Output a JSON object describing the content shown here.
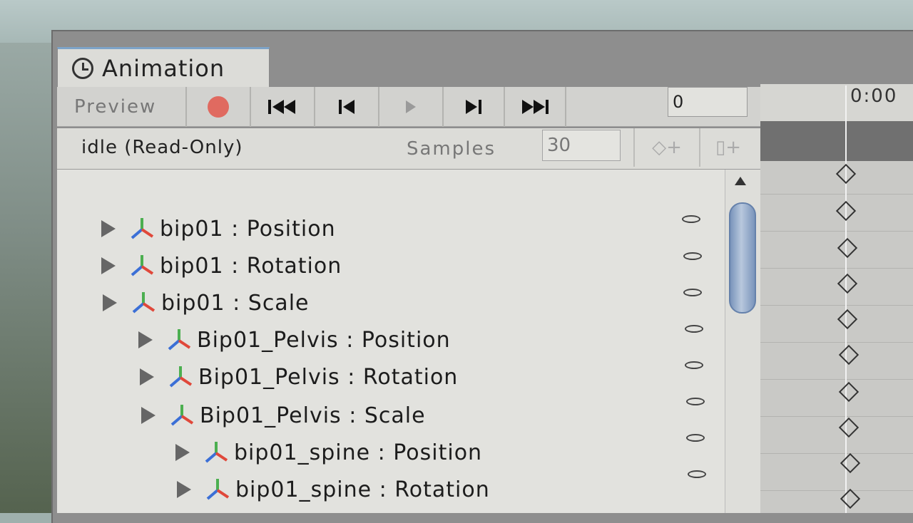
{
  "window": {
    "tab_title": "Animation"
  },
  "toolbar": {
    "preview_label": "Preview",
    "record_color": "#e06a60",
    "first_key_glyph": "⏮",
    "prev_key_glyph": "⏮",
    "play_glyph": "▶",
    "next_key_glyph": "⏭",
    "last_key_glyph": "⏭",
    "frame_value": "0"
  },
  "clip": {
    "name": "idle (Read-Only)",
    "samples_label": "Samples",
    "samples_value": "30",
    "add_keyframe_glyph": "◇+",
    "add_event_glyph": "▯+"
  },
  "timeline": {
    "time_label": "0:00"
  },
  "properties": [
    {
      "label": "bip01 : Position"
    },
    {
      "label": "bip01 : Rotation"
    },
    {
      "label": "bip01 : Scale"
    },
    {
      "label": "Bip01_Pelvis : Position"
    },
    {
      "label": "Bip01_Pelvis : Rotation"
    },
    {
      "label": "Bip01_Pelvis : Scale"
    },
    {
      "label": "bip01_spine : Position"
    },
    {
      "label": "bip01_spine : Rotation"
    }
  ]
}
